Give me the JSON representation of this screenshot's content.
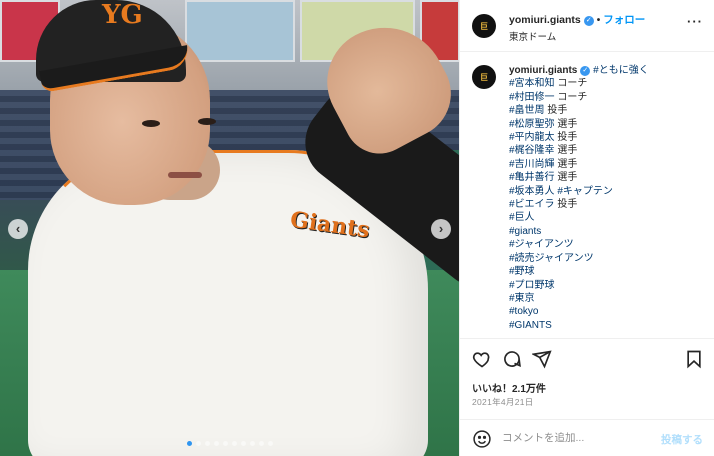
{
  "header": {
    "username": "yomiuri.giants",
    "follow_label": "フォロー",
    "separator": "•",
    "location": "東京ドーム",
    "avatar_text": "巨",
    "more_glyph": "···"
  },
  "photo": {
    "jersey_text": "Giants",
    "cap_logo": "YG",
    "prev_glyph": "‹",
    "next_glyph": "›",
    "slide_count": 10,
    "active_slide": 1
  },
  "caption": {
    "username": "yomiuri.giants",
    "lead_tag": "#ともに強く",
    "lines": [
      {
        "tag": "#宮本和知",
        "text": " コーチ"
      },
      {
        "tag": "#村田修一",
        "text": " コーチ"
      },
      {
        "tag": "#畠世周",
        "text": " 投手"
      },
      {
        "tag": "#松原聖弥",
        "text": " 選手"
      },
      {
        "tag": "#平内龍太",
        "text": " 投手"
      },
      {
        "tag": "#梶谷隆幸",
        "text": " 選手"
      },
      {
        "tag": "#吉川尚輝",
        "text": " 選手"
      },
      {
        "tag": "#亀井善行",
        "text": " 選手"
      },
      {
        "tag": "#坂本勇人",
        "text": " #キャプテン"
      },
      {
        "tag": "#ビエイラ",
        "text": " 投手"
      },
      {
        "tag": "#巨人",
        "text": ""
      },
      {
        "tag": "#giants",
        "text": ""
      },
      {
        "tag": "#ジャイアンツ",
        "text": ""
      },
      {
        "tag": "#読売ジャイアンツ",
        "text": ""
      },
      {
        "tag": "#野球",
        "text": ""
      },
      {
        "tag": "#プロ野球",
        "text": ""
      },
      {
        "tag": "#東京",
        "text": ""
      },
      {
        "tag": "#tokyo",
        "text": ""
      },
      {
        "tag": "#GIANTS",
        "text": ""
      }
    ]
  },
  "actions": {
    "likes_text": "いいね！2.1万件",
    "date_text": "2021年4月21日"
  },
  "comment": {
    "placeholder": "コメントを追加...",
    "post_label": "投稿する"
  },
  "colors": {
    "link": "#00376b",
    "follow": "#0095f6",
    "verified": "#3897f0",
    "muted": "#8e8e8e",
    "giants_orange": "#e77a1f"
  },
  "icons": [
    "heart-icon",
    "comment-icon",
    "share-icon",
    "bookmark-icon",
    "emoji-icon",
    "verified-badge-icon",
    "more-options-icon"
  ]
}
